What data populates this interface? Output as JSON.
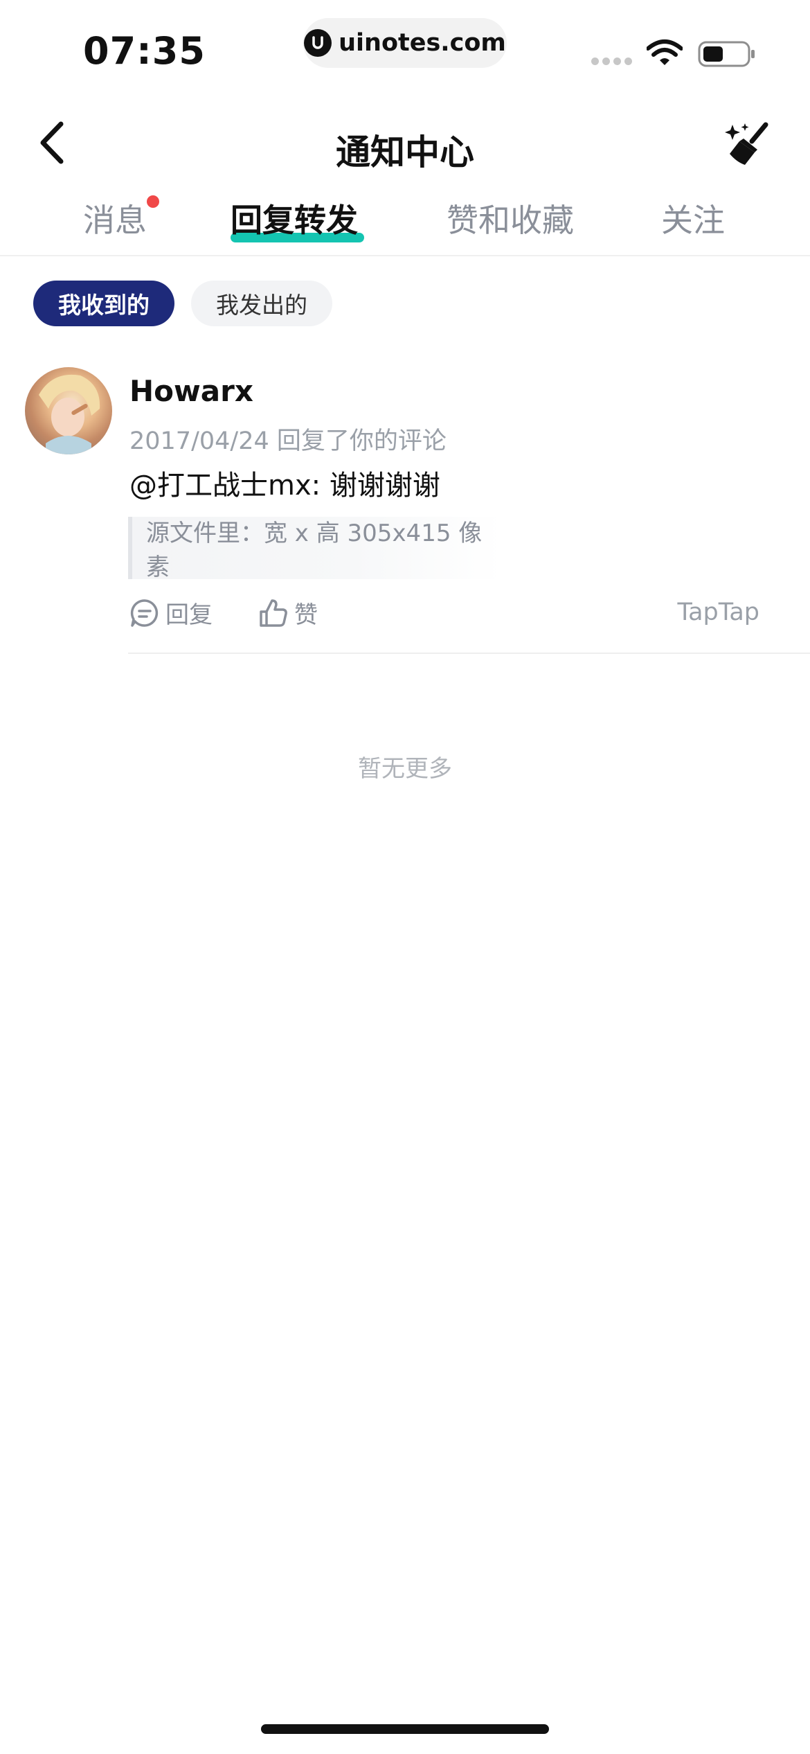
{
  "status_bar": {
    "time": "07:35",
    "url": "uinotes.com"
  },
  "nav": {
    "title": "通知中心",
    "back_icon": "chevron-left-icon",
    "clean_icon": "broom-sparkle-icon"
  },
  "tabs": [
    {
      "label": "消息",
      "has_dot": true
    },
    {
      "label": "回复转发",
      "active": true
    },
    {
      "label": "赞和收藏"
    },
    {
      "label": "关注"
    }
  ],
  "filters": {
    "received": "我收到的",
    "sent": "我发出的"
  },
  "notification": {
    "username": "Howarx",
    "meta": "2017/04/24 回复了你的评论",
    "reply": "@打工战士mx: 谢谢谢谢",
    "quote": "源文件里：宽 x 高 305x415 像素",
    "reply_action": "回复",
    "like_action": "赞",
    "source": "TapTap"
  },
  "footer": {
    "no_more": "暂无更多"
  },
  "colors": {
    "accent_underline": "#14c4b1",
    "active_pill": "#1e2a7a",
    "badge_dot": "#f04848"
  }
}
